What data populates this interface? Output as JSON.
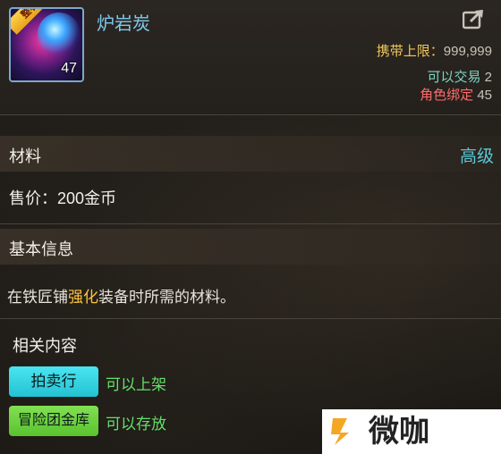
{
  "item": {
    "name": "炉岩炭",
    "count": "47",
    "ribbon_text": "整石",
    "icon": "lava-stone-icon"
  },
  "stats": {
    "carry_label": "携带上限：",
    "carry_value": "999,999",
    "trade_label": "可以交易",
    "trade_value": "2",
    "bound_label": "角色绑定",
    "bound_value": "45"
  },
  "category": {
    "type_label": "材料",
    "grade_label": "高级",
    "price_text": "售价：200金币"
  },
  "basic_info": {
    "title": "基本信息",
    "desc_before": "在铁匠铺",
    "desc_highlight": "强化",
    "desc_after": "装备时所需的材料。"
  },
  "related": {
    "title": "相关内容",
    "auction_button": "拍卖行",
    "auction_status": "可以上架",
    "storage_button": "冒险团金库",
    "storage_status": "可以存放"
  },
  "watermark": {
    "text": "微咖"
  },
  "colors": {
    "name": "#7ec9ee",
    "carry": "#f0c75a",
    "trade": "#7fd4c2",
    "bound": "#ff6b6b",
    "grade": "#59c9d6",
    "highlight": "#ffc53d",
    "status_green": "#62e06a",
    "auction_btn": "#2fd0de",
    "storage_btn": "#6cd140"
  }
}
